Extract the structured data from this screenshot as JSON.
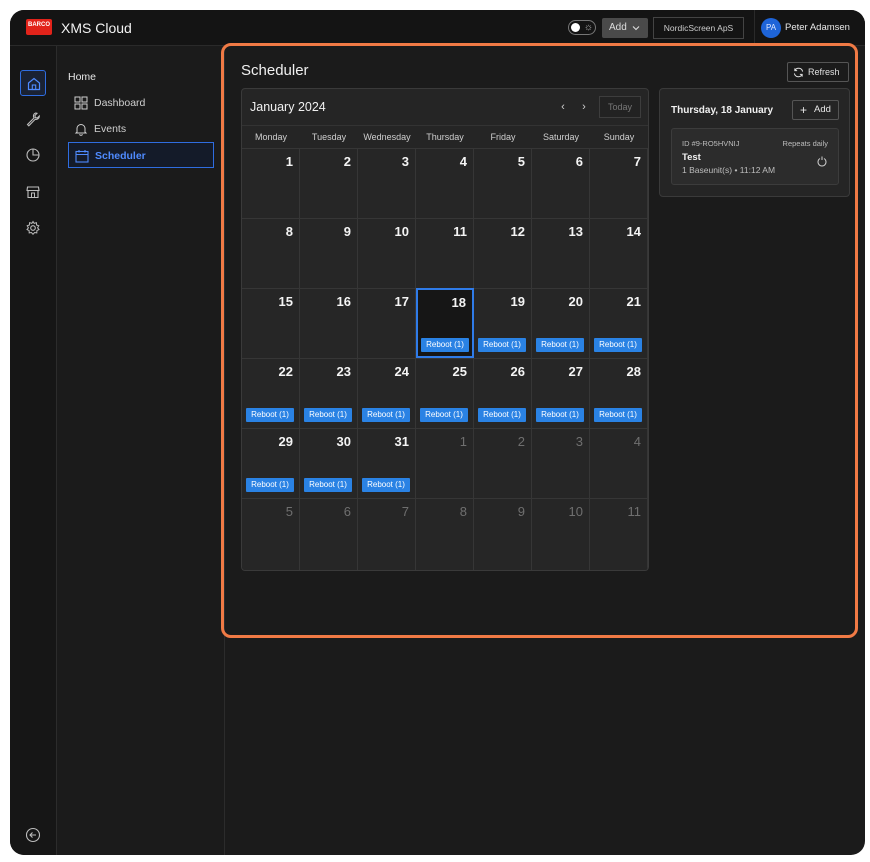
{
  "header": {
    "logo_text": "BARCO",
    "app_title_bold": "XMS",
    "app_title_light": " Cloud",
    "add_label": "Add",
    "organization": "NordicScreen ApS",
    "user_initials": "PA",
    "user_name": "Peter Adamsen"
  },
  "nav": {
    "home": "Home",
    "items": [
      {
        "label": "Dashboard"
      },
      {
        "label": "Events"
      },
      {
        "label": "Scheduler"
      }
    ]
  },
  "rail": {
    "icons": [
      "home-icon",
      "wrench-icon",
      "pie-chart-icon",
      "store-icon",
      "gear-icon"
    ],
    "collapse_icon": "collapse-left-icon"
  },
  "page": {
    "title": "Scheduler",
    "refresh_label": "Refresh"
  },
  "calendar": {
    "month_label": "January 2024",
    "prev": "‹",
    "next": "›",
    "today_label": "Today",
    "weekdays": [
      "Monday",
      "Tuesday",
      "Wednesday",
      "Thursday",
      "Friday",
      "Saturday",
      "Sunday"
    ],
    "event_label": "Reboot (1)",
    "selected_day": 18,
    "days": [
      {
        "d": "1",
        "m": false,
        "e": false
      },
      {
        "d": "2",
        "m": false,
        "e": false
      },
      {
        "d": "3",
        "m": false,
        "e": false
      },
      {
        "d": "4",
        "m": false,
        "e": false
      },
      {
        "d": "5",
        "m": false,
        "e": false
      },
      {
        "d": "6",
        "m": false,
        "e": false
      },
      {
        "d": "7",
        "m": false,
        "e": false
      },
      {
        "d": "8",
        "m": false,
        "e": false
      },
      {
        "d": "9",
        "m": false,
        "e": false
      },
      {
        "d": "10",
        "m": false,
        "e": false
      },
      {
        "d": "11",
        "m": false,
        "e": false
      },
      {
        "d": "12",
        "m": false,
        "e": false
      },
      {
        "d": "13",
        "m": false,
        "e": false
      },
      {
        "d": "14",
        "m": false,
        "e": false
      },
      {
        "d": "15",
        "m": false,
        "e": false
      },
      {
        "d": "16",
        "m": false,
        "e": false
      },
      {
        "d": "17",
        "m": false,
        "e": false
      },
      {
        "d": "18",
        "m": false,
        "e": true
      },
      {
        "d": "19",
        "m": false,
        "e": true
      },
      {
        "d": "20",
        "m": false,
        "e": true
      },
      {
        "d": "21",
        "m": false,
        "e": true
      },
      {
        "d": "22",
        "m": false,
        "e": true
      },
      {
        "d": "23",
        "m": false,
        "e": true
      },
      {
        "d": "24",
        "m": false,
        "e": true
      },
      {
        "d": "25",
        "m": false,
        "e": true
      },
      {
        "d": "26",
        "m": false,
        "e": true
      },
      {
        "d": "27",
        "m": false,
        "e": true
      },
      {
        "d": "28",
        "m": false,
        "e": true
      },
      {
        "d": "29",
        "m": false,
        "e": true
      },
      {
        "d": "30",
        "m": false,
        "e": true
      },
      {
        "d": "31",
        "m": false,
        "e": true
      },
      {
        "d": "1",
        "m": true,
        "e": false
      },
      {
        "d": "2",
        "m": true,
        "e": false
      },
      {
        "d": "3",
        "m": true,
        "e": false
      },
      {
        "d": "4",
        "m": true,
        "e": false
      },
      {
        "d": "5",
        "m": true,
        "e": false
      },
      {
        "d": "6",
        "m": true,
        "e": false
      },
      {
        "d": "7",
        "m": true,
        "e": false
      },
      {
        "d": "8",
        "m": true,
        "e": false
      },
      {
        "d": "9",
        "m": true,
        "e": false
      },
      {
        "d": "10",
        "m": true,
        "e": false
      },
      {
        "d": "11",
        "m": true,
        "e": false
      }
    ]
  },
  "day_panel": {
    "title": "Thursday, 18 January",
    "add_label": "Add",
    "event": {
      "id": "ID #9-RO5HVNIJ",
      "repeat": "Repeats daily",
      "name": "Test",
      "detail": "1 Baseunit(s) • 11:12 AM"
    }
  },
  "colors": {
    "accent": "#2f6de0",
    "event": "#2a82e4",
    "highlight": "#f07a45",
    "background": "#1b1b1b"
  }
}
